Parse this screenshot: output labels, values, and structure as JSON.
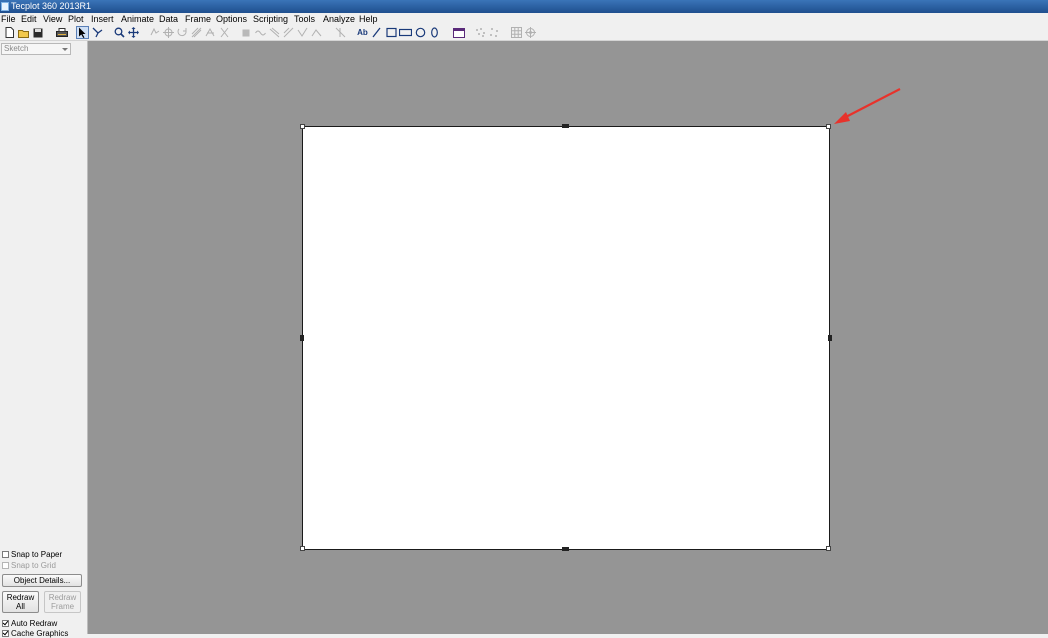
{
  "window": {
    "title": "Tecplot 360 2013R1"
  },
  "menu": {
    "items": [
      "File",
      "Edit",
      "View",
      "Plot",
      "Insert",
      "Animate",
      "Data",
      "Frame",
      "Options",
      "Scripting",
      "Tools",
      "Analyze",
      "Help"
    ]
  },
  "toolbar": {
    "icons": [
      "new-file-icon",
      "open-folder-icon",
      "save-icon",
      "print-icon",
      "select-arrow-icon",
      "adjustor-icon",
      "zoom-icon",
      "translate-icon",
      "rotate-icon",
      "probe-icon",
      "contour-icon",
      "streamtrace-icon",
      "slice-icon",
      "text-icon",
      "line-icon",
      "rectangle-icon",
      "circle-icon",
      "ellipse-icon",
      "frame-icon",
      "scatter-icon",
      "grid-icon",
      "target-icon"
    ],
    "text_tool_label": "Ab"
  },
  "sidebar": {
    "mode_dropdown": "Sketch",
    "snap_to_paper": {
      "label": "Snap to Paper",
      "checked": false
    },
    "snap_to_grid": {
      "label": "Snap to Grid",
      "checked": false
    },
    "object_details": "Object Details...",
    "redraw_all": [
      "Redraw",
      "All"
    ],
    "redraw_frame": [
      "Redraw",
      "Frame"
    ],
    "auto_redraw": {
      "label": "Auto Redraw",
      "checked": true
    },
    "cache_graphics": {
      "label": "Cache Graphics",
      "checked": true
    }
  },
  "colors": {
    "titlebar": "#2a5fa0",
    "workspace": "#959595",
    "frame": "#ffffff",
    "annotation_arrow": "#e8322b"
  }
}
